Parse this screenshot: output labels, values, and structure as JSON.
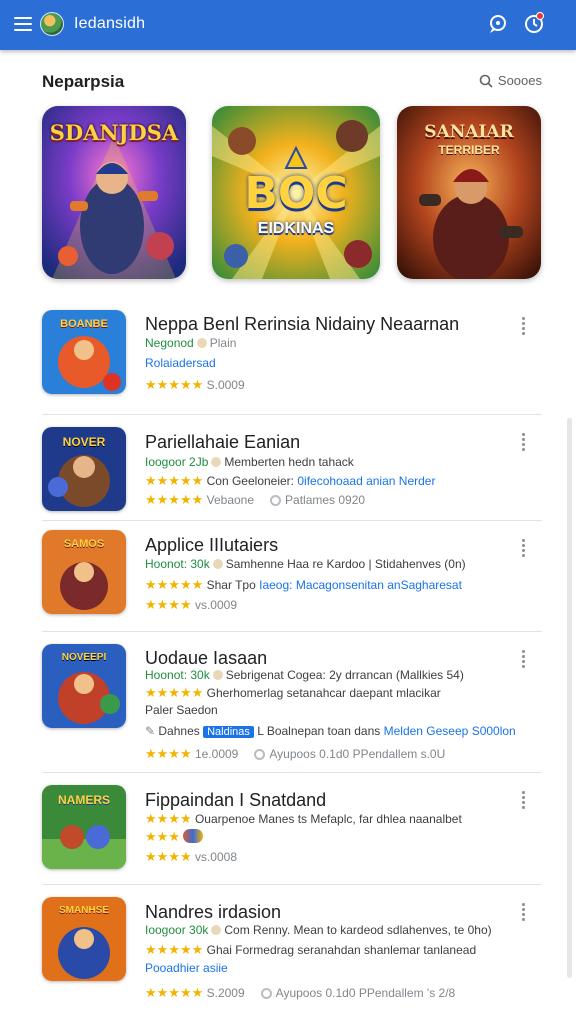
{
  "appbar": {
    "title": "Iedansidh"
  },
  "section": {
    "title": "Neparpsia",
    "search_label": "Soooes"
  },
  "featured": [
    {
      "label": "SDANJDSA",
      "sub": ""
    },
    {
      "label": "BOC",
      "sub": "EIDKINAS"
    },
    {
      "label": "SANAIAR",
      "sub": "TERRIBER"
    }
  ],
  "list": [
    {
      "title": "Neppa Benl Rerinsia Nidainy Neaarnan",
      "thumb_label": "BOANBE",
      "line1_a": "Negonod",
      "line1_b": "Plain",
      "line2": "Rolaiadersad",
      "rating_text": "S.0009"
    },
    {
      "title": "Pariellahaie Eanian",
      "thumb_label": "NOVER",
      "line1_a": "Ioogoor 2Jb",
      "line1_b": "Memberten hedn tahack",
      "line2_a": "Con Geeloneier:",
      "line2_b": "0ifecohoaad anian Nerder",
      "line3_a": "Vebaone",
      "line3_b": "Patlames 0920"
    },
    {
      "title": "Applice IIIutaiers",
      "thumb_label": "SAMOS",
      "line1_a": "Hoonot: 30k",
      "line1_b": "Samhenne Haa re Kardoo | Stidahenves (0n)",
      "line2_a": "Shar Tpo",
      "line2_b": "Iaeog: Macagonsenitan anSagharesat",
      "line3": "vs.0009"
    },
    {
      "title": "Uodaue Iasaan",
      "thumb_label": "NOVEEPI",
      "line1_a": "Hoonot: 30k",
      "line1_b": "Sebrigenat Cogea: 2y drrancan (Mallkies 54)",
      "line2": "Gherhomerlag setanahcar daepant mlacikar",
      "line3": "Paler Saedon",
      "line4_a": "Dahnes",
      "line4_pill": "Naldinas",
      "line4_b": "L Boalnepan toan dans",
      "line4_c": "Melden Geseep",
      "line4_d": "S000lon",
      "line5_a": "1e.0009",
      "line5_b": "Ayupoos 0.1d0",
      "line5_c": "PPendallem s.0U"
    },
    {
      "title": "Fippaindan I Snatdand",
      "thumb_label": "NAMERS",
      "line1": "Ouarpenoe Manes ts Mefaplc, far dhlea naanalbet",
      "line3": "vs.0008"
    },
    {
      "title": "Nandres irdasion",
      "thumb_label": "SMANHSE",
      "line1_a": "Ioogoor 30k",
      "line1_b": "Com Renny. Mean to kardeod sdlahenves, te 0ho)",
      "line2": "Ghai Formedrag seranahdan shanlemar tanlanead",
      "line3": "Pooadhier asiie",
      "line4_a": "S.2009",
      "line4_b": "Ayupoos 0.1d0",
      "line4_c": "PPendallem 's 2/8"
    }
  ],
  "colors": {
    "appbar": "#2b6fd6",
    "star": "#f2b400",
    "link": "#1a73e8",
    "green": "#1e8e3e"
  },
  "icons": [
    "menu-icon",
    "chat-icon",
    "bell-icon",
    "search-icon",
    "more-vert-icon"
  ]
}
